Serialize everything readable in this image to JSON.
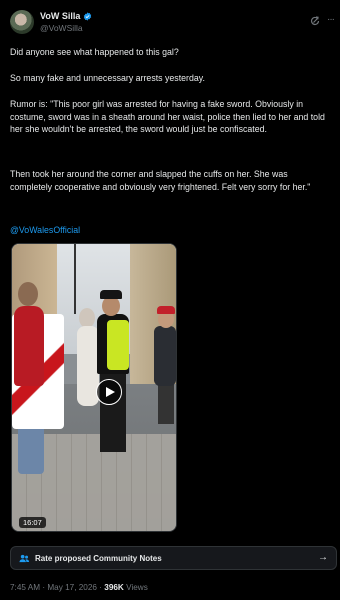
{
  "author": {
    "display_name": "VoW Silla",
    "handle": "@VoWSilla",
    "verified_color": "#1d9bf0"
  },
  "post": {
    "paragraphs": [
      "Did anyone see what happened to this gal?",
      "So many fake and unnecessary arrests yesterday.",
      "Rumor is: \"This poor girl was arrested for having a fake sword. Obviously in costume, sword was in a sheath around her waist, police then lied to her and told her she wouldn't be arrested, the sword would just be confiscated.",
      "Then took her around the corner and slapped the cuffs on her. She was completely cooperative and obviously very frightened. Felt very sorry for her.\""
    ],
    "mention": "@VoWalesOfficial"
  },
  "media": {
    "duration": "16:07",
    "play_icon": "play-icon"
  },
  "community_notes": {
    "label": "Rate proposed Community Notes",
    "icon": "people-icon",
    "arrow_icon": "arrow-right-icon"
  },
  "meta": {
    "time": "7:45 AM",
    "separator": "·",
    "date": "May 17, 2026",
    "views_count": "396K",
    "views_label": "Views"
  },
  "colors": {
    "background": "#000000",
    "text": "#e7e9ea",
    "secondary": "#71767b",
    "accent": "#1d9bf0"
  }
}
